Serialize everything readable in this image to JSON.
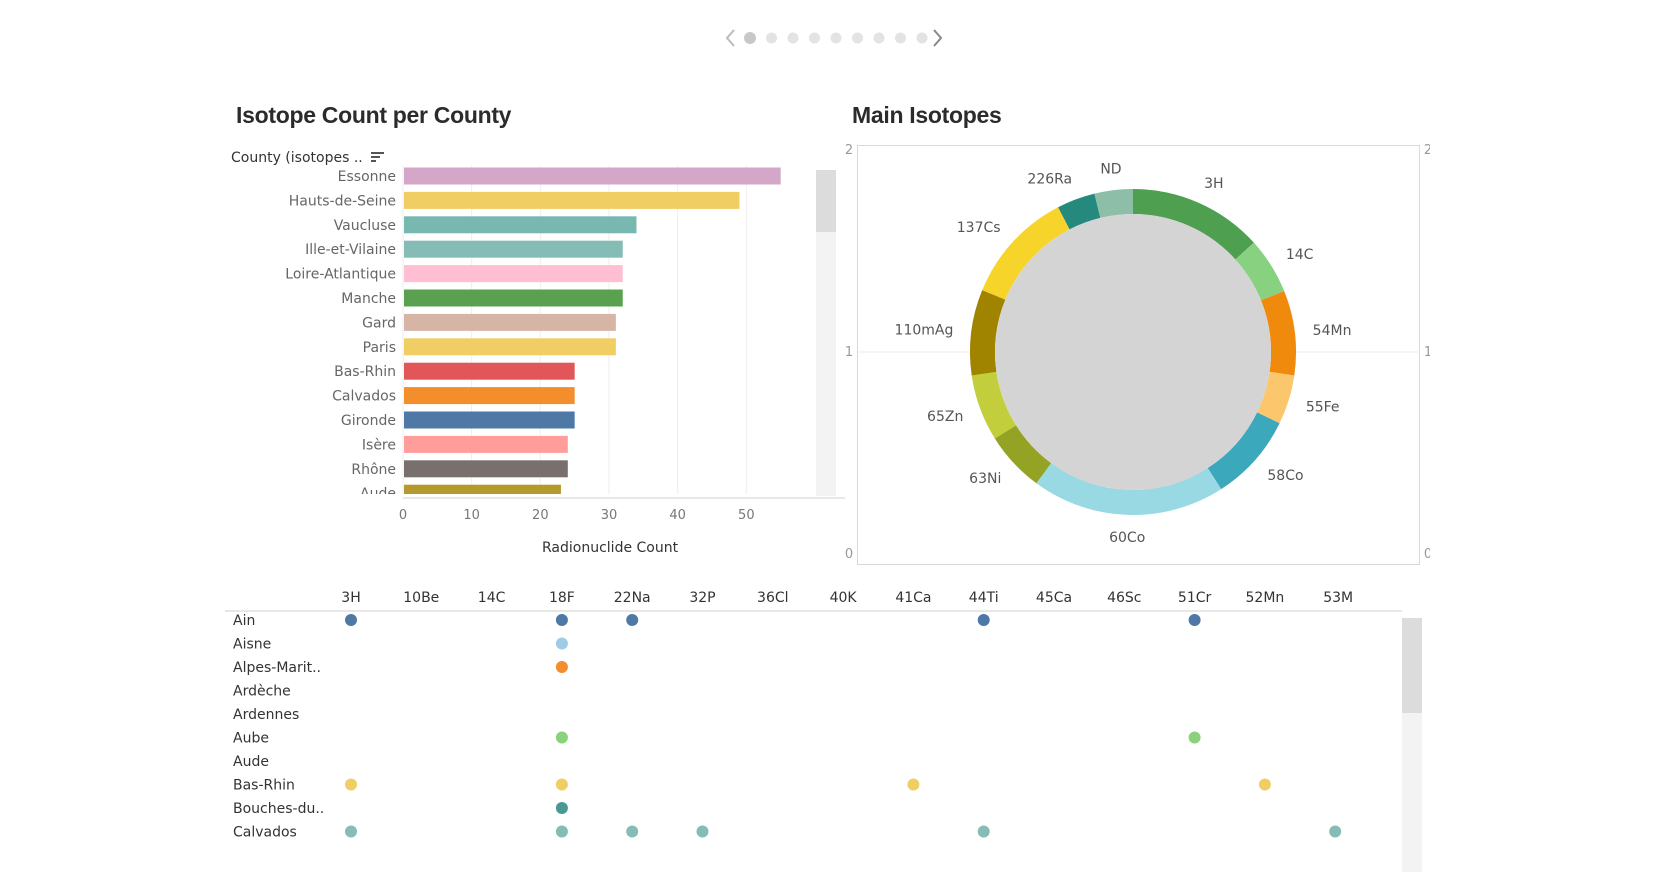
{
  "pager": {
    "dot_count": 9,
    "active_index": 0
  },
  "left_panel": {
    "title": "Isotope Count per County",
    "header_label": "County (isotopes ..",
    "sort_icon": "sort-desc-icon"
  },
  "right_panel": {
    "title": "Main Isotopes",
    "left_axis_labels": [
      "2",
      "1",
      "0"
    ],
    "right_axis_labels": [
      "2",
      "1",
      "0"
    ]
  },
  "chart_data": [
    {
      "type": "bar",
      "orientation": "horizontal",
      "categories": [
        "Essonne",
        "Hauts-de-Seine",
        "Vaucluse",
        "Ille-et-Vilaine",
        "Loire-Atlantique",
        "Manche",
        "Gard",
        "Paris",
        "Bas-Rhin",
        "Calvados",
        "Gironde",
        "Isère",
        "Rhône",
        "Aude"
      ],
      "values": [
        55,
        49,
        34,
        32,
        32,
        32,
        31,
        31,
        25,
        25,
        25,
        24,
        24,
        23
      ],
      "colors": [
        "#d4a6c8",
        "#f1ce63",
        "#79b8b0",
        "#86bcb6",
        "#ffbed2",
        "#59a14f",
        "#d7b5a6",
        "#f1ce63",
        "#e15759",
        "#f28e2b",
        "#4e79a7",
        "#ff9d9a",
        "#79706e",
        "#b6992d"
      ],
      "xlabel": "Radionuclide Count",
      "ylabel": "County (isotopes ..",
      "xticks": [
        0,
        10,
        20,
        30,
        40,
        50
      ],
      "xlim": [
        0,
        60
      ]
    },
    {
      "type": "pie",
      "style": "donut",
      "labels": [
        "3H",
        "14C",
        "54Mn",
        "55Fe",
        "58Co",
        "60Co",
        "63Ni",
        "65Zn",
        "110mAg",
        "137Cs",
        "226Ra",
        "ND"
      ],
      "values": [
        13.3,
        5.6,
        8.4,
        4.9,
        8.7,
        19.2,
        6.0,
        6.6,
        8.5,
        11.2,
        3.8,
        3.8
      ],
      "colors": [
        "#4e9f50",
        "#87d180",
        "#ef8a0c",
        "#fcc66d",
        "#3ca8bc",
        "#98d9e4",
        "#94a323",
        "#c3ce3d",
        "#a08400",
        "#f7d42a",
        "#26897e",
        "#8dbfa8"
      ],
      "center_color": "#d4d4d4"
    },
    {
      "type": "scatter",
      "style": "dot-matrix",
      "columns": [
        "3H",
        "10Be",
        "14C",
        "18F",
        "22Na",
        "32P",
        "36Cl",
        "40K",
        "41Ca",
        "44Ti",
        "45Ca",
        "46Sc",
        "51Cr",
        "52Mn",
        "53M"
      ],
      "rows": [
        "Ain",
        "Aisne",
        "Alpes-Marit..",
        "Ardèche",
        "Ardennes",
        "Aube",
        "Aude",
        "Bas-Rhin",
        "Bouches-du..",
        "Calvados"
      ],
      "points": [
        {
          "row": "Ain",
          "col": "3H",
          "color": "#4e79a7"
        },
        {
          "row": "Ain",
          "col": "18F",
          "color": "#4e79a7"
        },
        {
          "row": "Ain",
          "col": "22Na",
          "color": "#4e79a7"
        },
        {
          "row": "Ain",
          "col": "44Ti",
          "color": "#4e79a7"
        },
        {
          "row": "Ain",
          "col": "51Cr",
          "color": "#4e79a7"
        },
        {
          "row": "Aisne",
          "col": "18F",
          "color": "#a0cbe8"
        },
        {
          "row": "Alpes-Marit..",
          "col": "18F",
          "color": "#f28e2b"
        },
        {
          "row": "Aube",
          "col": "18F",
          "color": "#8cd17d"
        },
        {
          "row": "Aube",
          "col": "51Cr",
          "color": "#8cd17d"
        },
        {
          "row": "Bas-Rhin",
          "col": "3H",
          "color": "#f1ce63"
        },
        {
          "row": "Bas-Rhin",
          "col": "18F",
          "color": "#f1ce63"
        },
        {
          "row": "Bas-Rhin",
          "col": "41Ca",
          "color": "#f1ce63"
        },
        {
          "row": "Bas-Rhin",
          "col": "52Mn",
          "color": "#f1ce63"
        },
        {
          "row": "Bouches-du..",
          "col": "18F",
          "color": "#499894"
        },
        {
          "row": "Calvados",
          "col": "3H",
          "color": "#86bcb6"
        },
        {
          "row": "Calvados",
          "col": "18F",
          "color": "#86bcb6"
        },
        {
          "row": "Calvados",
          "col": "22Na",
          "color": "#86bcb6"
        },
        {
          "row": "Calvados",
          "col": "32P",
          "color": "#86bcb6"
        },
        {
          "row": "Calvados",
          "col": "44Ti",
          "color": "#86bcb6"
        },
        {
          "row": "Calvados",
          "col": "53M",
          "color": "#86bcb6"
        }
      ]
    }
  ]
}
